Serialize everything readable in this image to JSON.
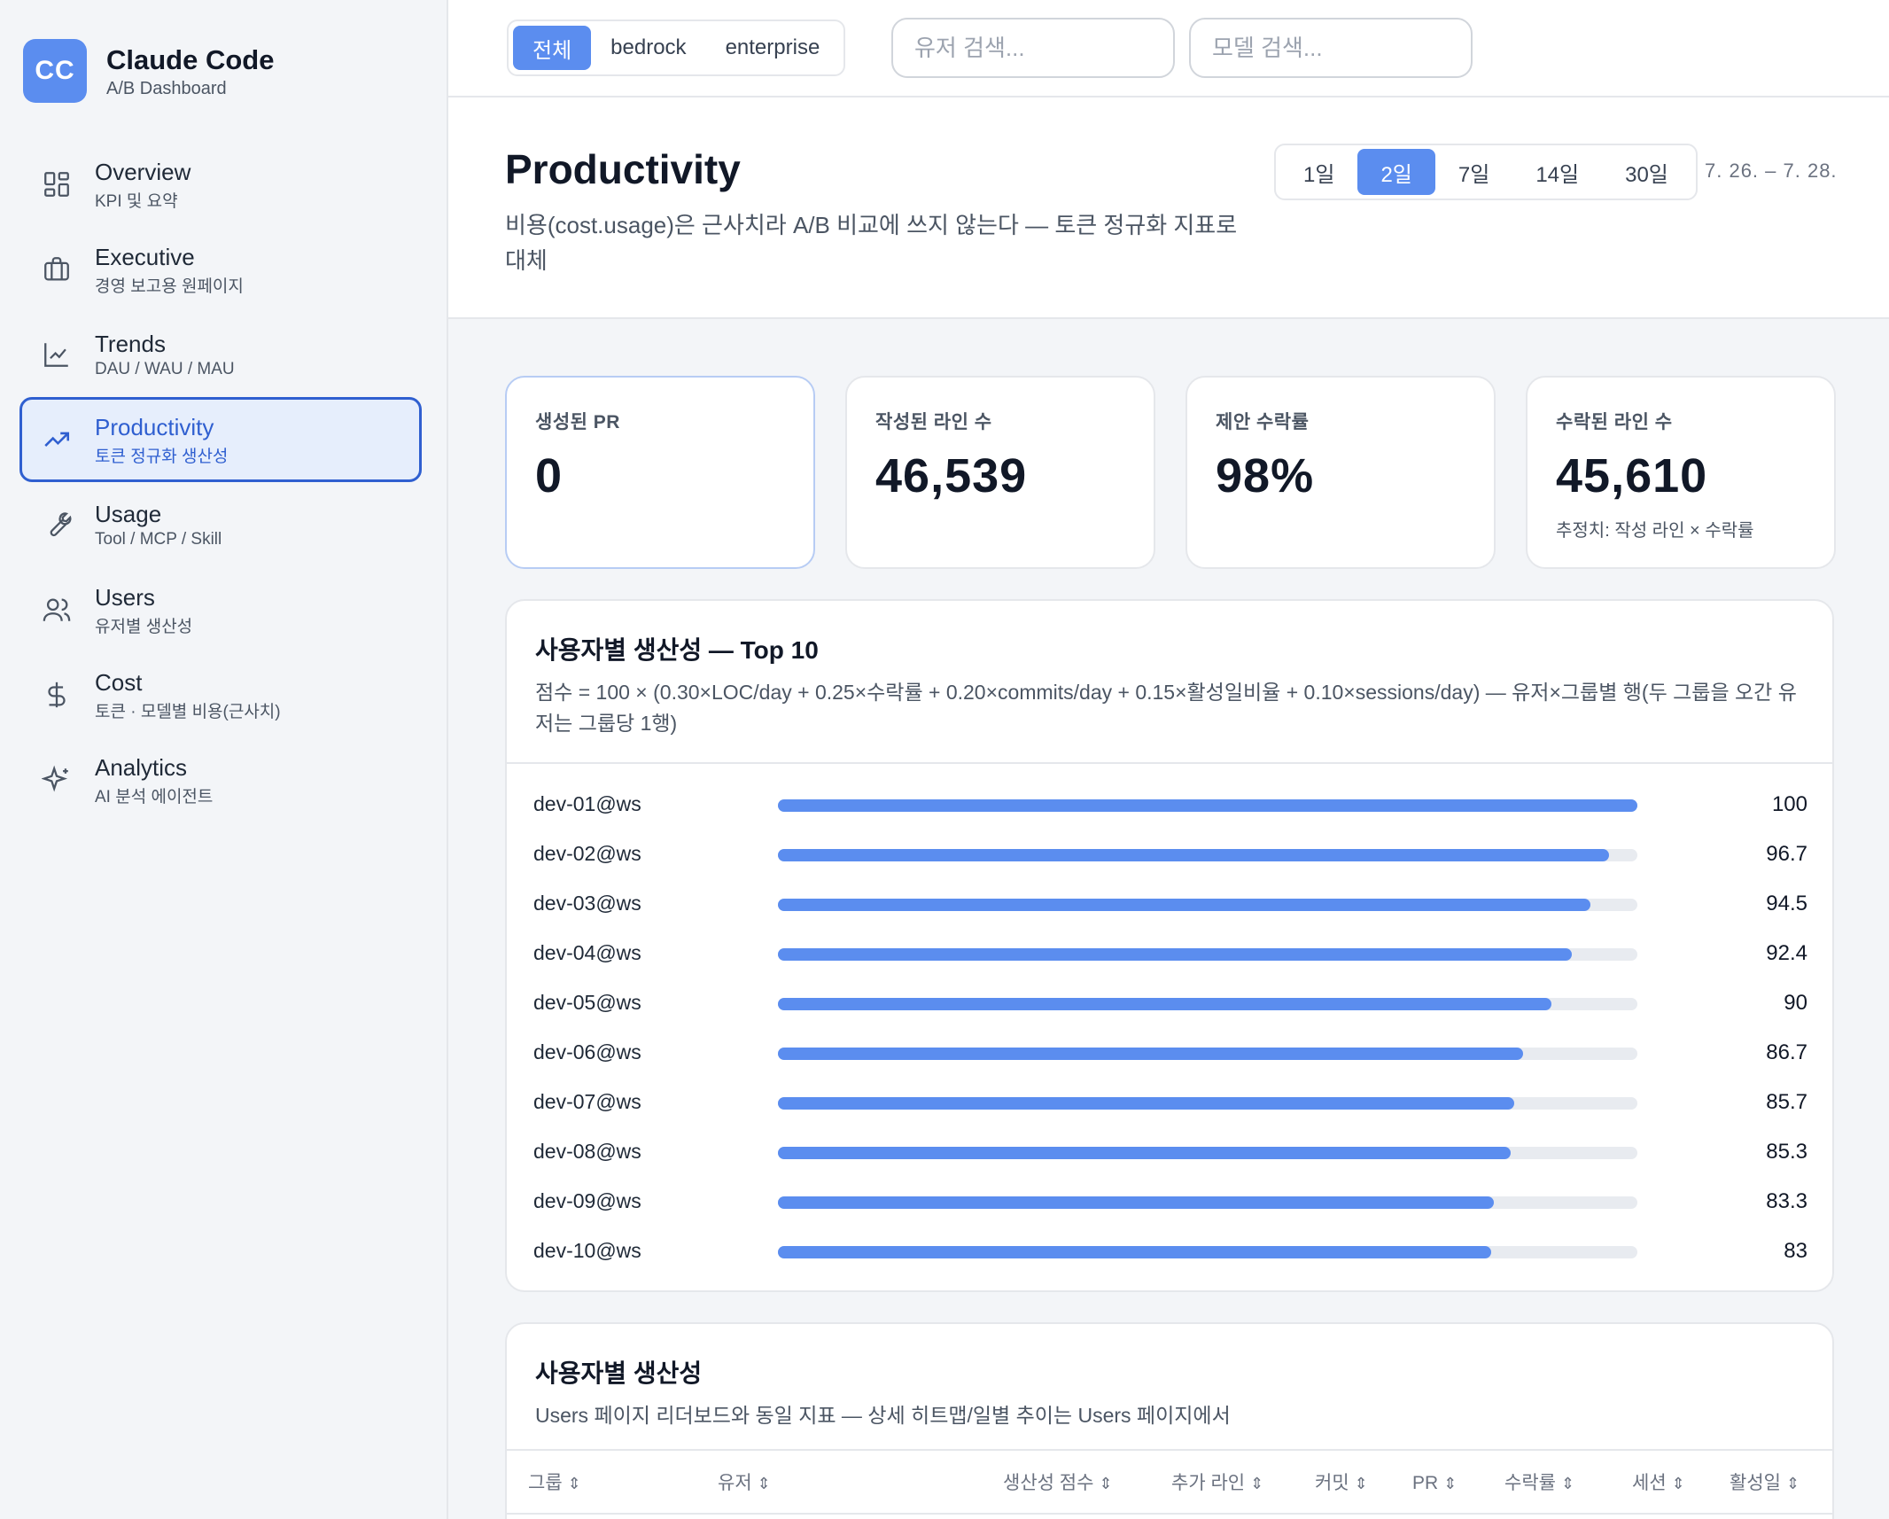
{
  "brand": {
    "logo": "CC",
    "title": "Claude Code",
    "subtitle": "A/B Dashboard"
  },
  "nav": [
    {
      "label": "Overview",
      "desc": "KPI 및 요약",
      "icon": "grid-icon"
    },
    {
      "label": "Executive",
      "desc": "경영 보고용 원페이지",
      "icon": "briefcase-icon"
    },
    {
      "label": "Trends",
      "desc": "DAU / WAU / MAU",
      "icon": "line-chart-icon"
    },
    {
      "label": "Productivity",
      "desc": "토큰 정규화 생산성",
      "icon": "trending-up-icon",
      "active": true
    },
    {
      "label": "Usage",
      "desc": "Tool / MCP / Skill",
      "icon": "wrench-icon"
    },
    {
      "label": "Users",
      "desc": "유저별 생산성",
      "icon": "users-icon"
    },
    {
      "label": "Cost",
      "desc": "토큰 · 모델별 비용(근사치)",
      "icon": "dollar-icon"
    },
    {
      "label": "Analytics",
      "desc": "AI 분석 에이전트",
      "icon": "sparkles-icon"
    }
  ],
  "filters": {
    "groups": [
      "전체",
      "bedrock",
      "enterprise"
    ],
    "active_group": "전체",
    "user_search_placeholder": "유저 검색...",
    "model_search_placeholder": "모델 검색..."
  },
  "page": {
    "title": "Productivity",
    "description": "비용(cost.usage)은 근사치라 A/B 비교에 쓰지 않는다 — 토큰 정규화 지표로 대체",
    "ranges": [
      "1일",
      "2일",
      "7일",
      "14일",
      "30일"
    ],
    "active_range": "2일",
    "date_range": "7. 26. – 7. 28."
  },
  "kpis": [
    {
      "label": "생성된 PR",
      "value": "0",
      "note": ""
    },
    {
      "label": "작성된 라인 수",
      "value": "46,539",
      "note": ""
    },
    {
      "label": "제안 수락률",
      "value": "98%",
      "note": ""
    },
    {
      "label": "수락된 라인 수",
      "value": "45,610",
      "note": "추정치: 작성 라인 × 수락률"
    }
  ],
  "top10": {
    "title": "사용자별 생산성 — Top 10",
    "description": "점수 = 100 × (0.30×LOC/day + 0.25×수락률 + 0.20×commits/day + 0.15×활성일비율 + 0.10×sessions/day) — 유저×그룹별 행(두 그룹을 오간 유저는 그룹당 1행)",
    "max": 100,
    "rows": [
      {
        "user": "dev-01@ws",
        "score": 100,
        "label": "100"
      },
      {
        "user": "dev-02@ws",
        "score": 96.7,
        "label": "96.7"
      },
      {
        "user": "dev-03@ws",
        "score": 94.5,
        "label": "94.5"
      },
      {
        "user": "dev-04@ws",
        "score": 92.4,
        "label": "92.4"
      },
      {
        "user": "dev-05@ws",
        "score": 90,
        "label": "90"
      },
      {
        "user": "dev-06@ws",
        "score": 86.7,
        "label": "86.7"
      },
      {
        "user": "dev-07@ws",
        "score": 85.7,
        "label": "85.7"
      },
      {
        "user": "dev-08@ws",
        "score": 85.3,
        "label": "85.3"
      },
      {
        "user": "dev-09@ws",
        "score": 83.3,
        "label": "83.3"
      },
      {
        "user": "dev-10@ws",
        "score": 83,
        "label": "83"
      }
    ]
  },
  "table": {
    "title": "사용자별 생산성",
    "description": "Users 페이지 리더보드와 동일 지표 — 상세 히트맵/일별 추이는 Users 페이지에서",
    "columns": [
      "그룹",
      "유저",
      "생산성 점수",
      "추가 라인",
      "커밋",
      "PR",
      "수락률",
      "세션",
      "활성일"
    ],
    "sort_icon": "⇕"
  },
  "colors": {
    "accent": "#5b8def",
    "active_border": "#2f5fd0",
    "active_bg": "#e6eefc"
  }
}
